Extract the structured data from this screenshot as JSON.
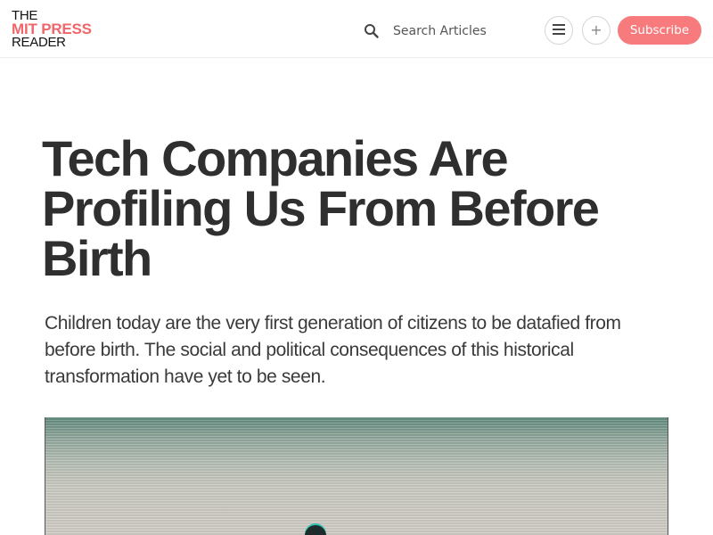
{
  "header": {
    "logo": {
      "line1": "THE",
      "line2": "MIT PRESS",
      "line3": "READER"
    },
    "search": {
      "placeholder": "Search Articles"
    },
    "menu_icon": "hamburger-menu-icon",
    "plus_label": "+",
    "subscribe_label": "Subscribe"
  },
  "article": {
    "title": "Tech Companies Are Profiling Us From Before Birth",
    "dek": "Children today are the very first generation of citizens to be datafied from before birth. The social and political consequences of this historical transformation have yet to be seen."
  },
  "colors": {
    "brand": "#f0666a",
    "subscribe_bg": "#f77a7c",
    "text": "#2f2f2f"
  }
}
